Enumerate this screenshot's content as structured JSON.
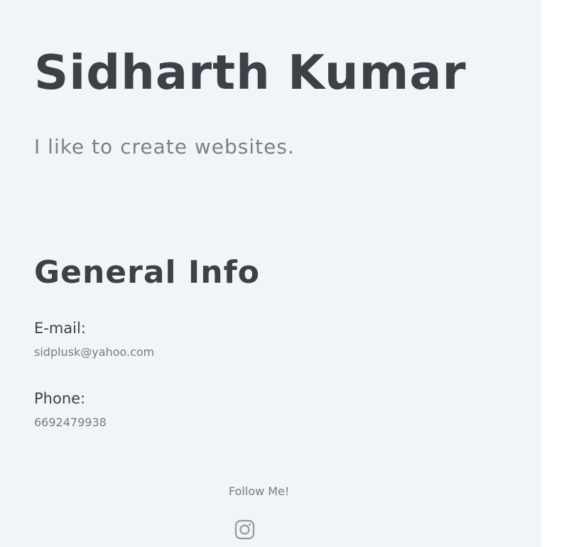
{
  "profile": {
    "name": "Sidharth Kumar",
    "tagline": "I like to create websites."
  },
  "general_info": {
    "title": "General Info",
    "email_label": "E-mail:",
    "email_value": "sidplusk@yahoo.com",
    "phone_label": "Phone:",
    "phone_value": "6692479938"
  },
  "social": {
    "follow_label": "Follow Me!",
    "icons": [
      "instagram-icon"
    ]
  },
  "colors": {
    "panel_background": "#f0f5f8",
    "heading_text": "#3e4047",
    "muted_text": "#808080"
  }
}
